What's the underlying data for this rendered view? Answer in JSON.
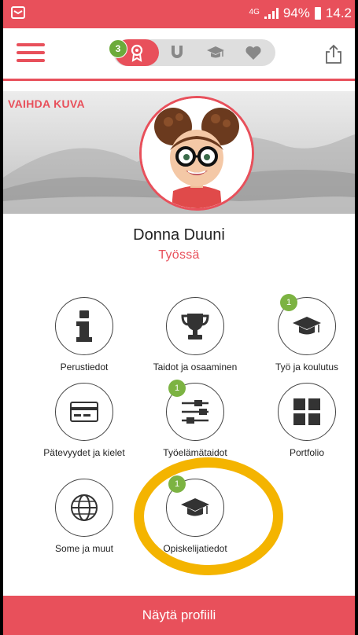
{
  "statusbar": {
    "network": "4G",
    "battery": "94%",
    "time": "14.2",
    "notification_icon": "mail-icon"
  },
  "appbar": {
    "tab_badge": "3",
    "tabs": [
      "award-icon",
      "magnet-icon",
      "graduation-cap-icon",
      "heart-icon"
    ],
    "share_icon": "share-icon"
  },
  "profile": {
    "change_photo": "VAIHDA KUVA",
    "name": "Donna Duuni",
    "status": "Työssä"
  },
  "items": [
    {
      "label": "Perustiedot",
      "icon": "info-icon",
      "badge": ""
    },
    {
      "label": "Taidot ja osaaminen",
      "icon": "trophy-icon",
      "badge": ""
    },
    {
      "label": "Työ ja koulutus",
      "icon": "graduation-cap-icon",
      "badge": "1"
    },
    {
      "label": "Pätevyydet ja kielet",
      "icon": "card-icon",
      "badge": ""
    },
    {
      "label": "Työelämätaidot",
      "icon": "sliders-icon",
      "badge": "1"
    },
    {
      "label": "Portfolio",
      "icon": "grid-icon",
      "badge": ""
    },
    {
      "label": "Some ja muut",
      "icon": "globe-icon",
      "badge": ""
    },
    {
      "label": "Opiskelijatiedot",
      "icon": "graduation-cap-icon",
      "badge": "1"
    }
  ],
  "bottom_button": "Näytä profiili",
  "colors": {
    "accent": "#e8505b",
    "badge": "#7cb342",
    "highlight": "#f4b400"
  }
}
